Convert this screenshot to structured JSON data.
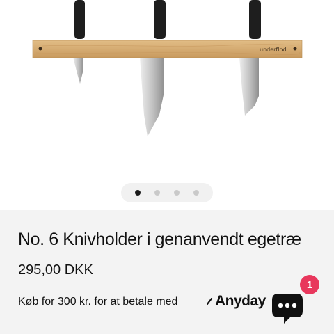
{
  "gallery": {
    "image_alt": "Knivholder i egetræ med tre knive",
    "brand_mark": "underflod",
    "slide_count": 4,
    "active_slide": 1
  },
  "product": {
    "title": "No. 6 Knivholder i genanvendt egetræ",
    "price": "295,00 DKK"
  },
  "installment": {
    "text": "Køb for 300 kr. for at betale med",
    "provider": "Anyday"
  },
  "chat": {
    "icon": "chat-bubble-icon",
    "badge": "1"
  },
  "colors": {
    "background": "#ffffff",
    "info_panel": "#f3f3f3",
    "badge": "#e8375c",
    "chat_button": "#111111",
    "wood": "#d6ad74"
  }
}
